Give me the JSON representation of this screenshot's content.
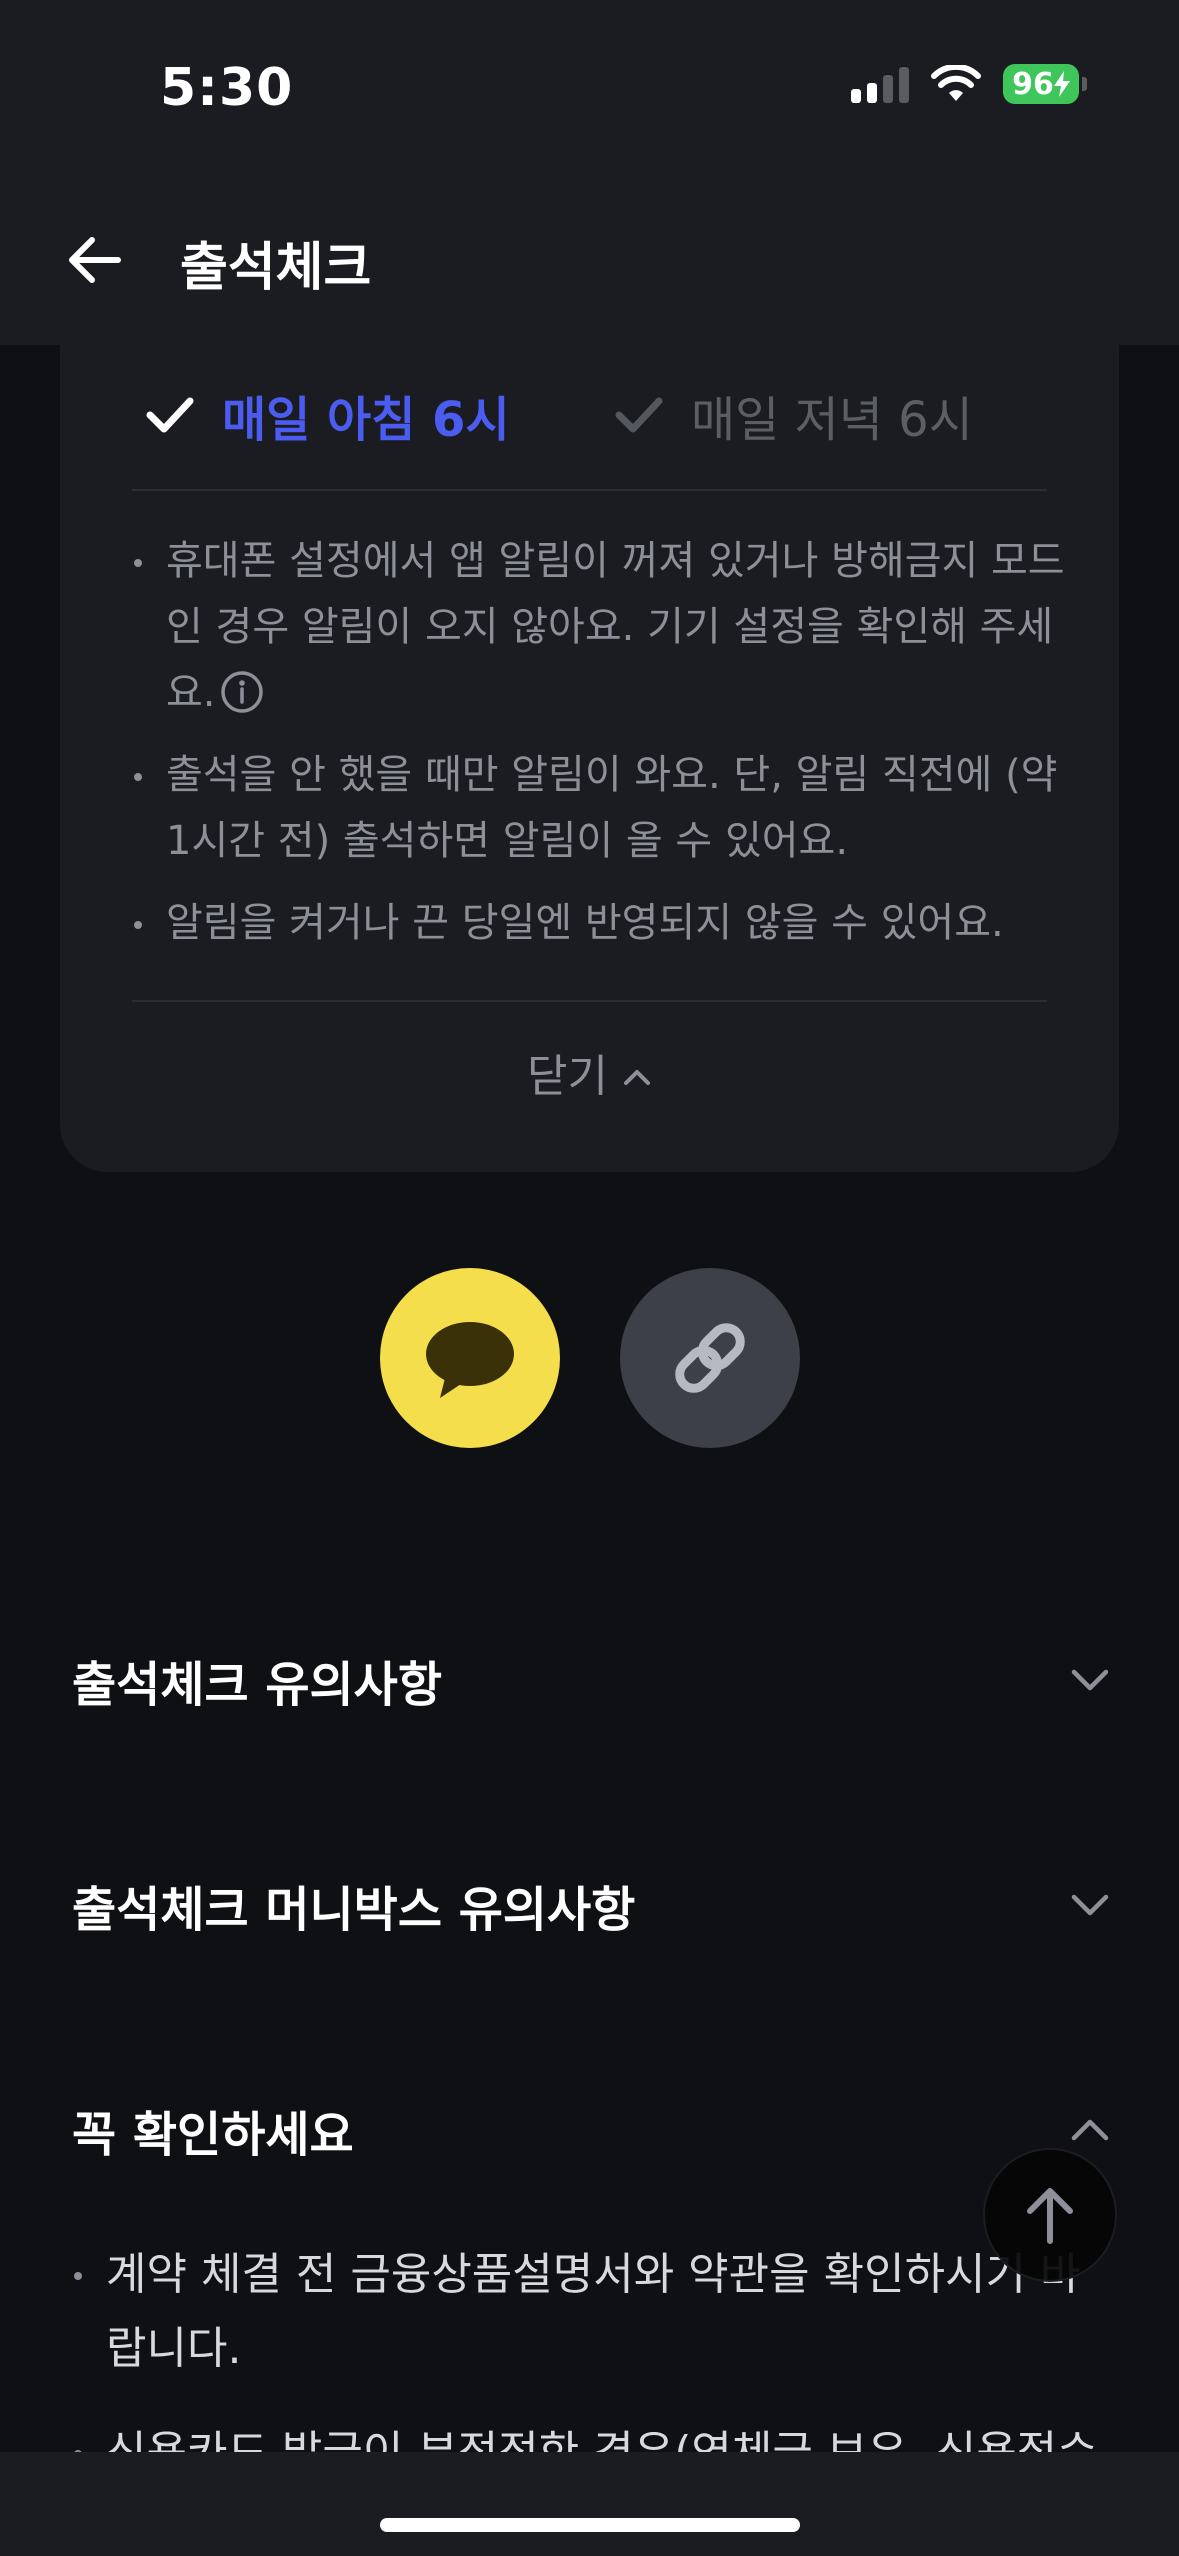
{
  "status_bar": {
    "time": "5:30",
    "battery": "96"
  },
  "header": {
    "title": "출석체크"
  },
  "alarm_card": {
    "options": [
      {
        "label": "매일 아침 6시",
        "selected": true
      },
      {
        "label": "매일 저녁 6시",
        "selected": false
      }
    ],
    "notes": [
      "휴대폰 설정에서 앱 알림이 꺼져 있거나 방해금지 모드인 경우 알림이 오지 않아요. 기기 설정을 확인해 주세요.",
      "출석을 안 했을 때만 알림이 와요. 단, 알림 직전에 (약 1시간 전) 출석하면 알림이 올 수 있어요.",
      "알림을 켜거나 끈 당일엔 반영되지 않을 수 있어요."
    ],
    "close_label": "닫기"
  },
  "accordions": [
    {
      "title": "출석체크 유의사항",
      "expanded": false
    },
    {
      "title": "출석체크 머니박스 유의사항",
      "expanded": false
    },
    {
      "title": "꼭 확인하세요",
      "expanded": true
    }
  ],
  "notice_items": [
    "계약 체결 전 금융상품설명서와 약관을 확인하시기 바랍니다.",
    "신용카드 발급이 부적정한 경우(연체금 보유, 신용점수"
  ],
  "colors": {
    "accent": "#4b5cf0",
    "kakao": "#f5de4b",
    "background": "#0f1014",
    "card": "#1b1c21"
  }
}
